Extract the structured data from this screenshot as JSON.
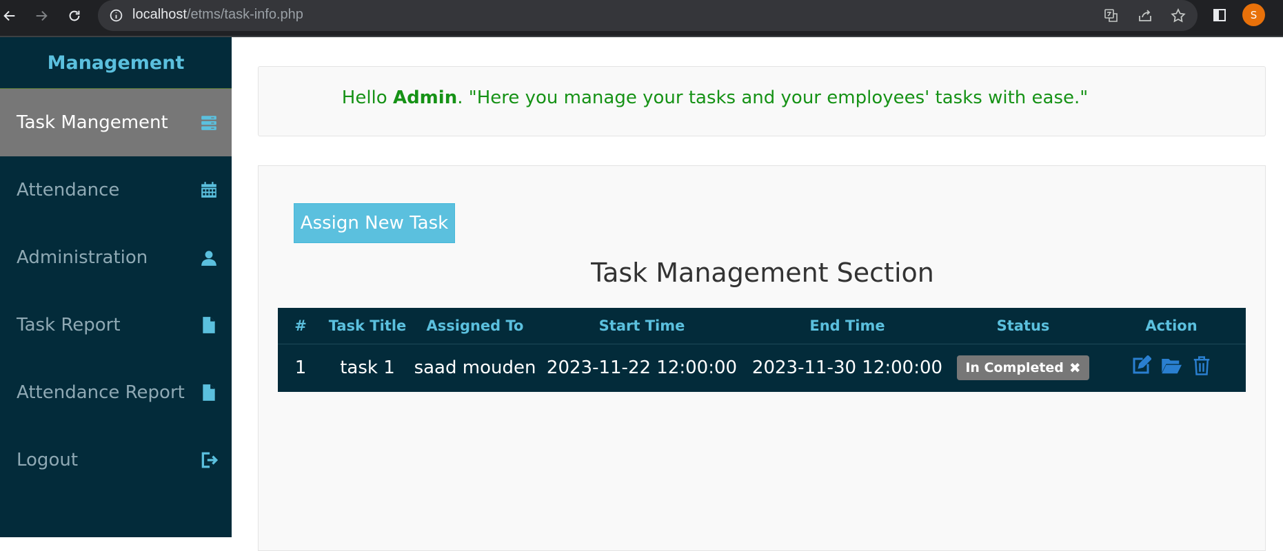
{
  "browser": {
    "url_host": "localhost",
    "url_path": "/etms/task-info.php",
    "profile_initial": "S"
  },
  "sidebar": {
    "title": "Management",
    "items": [
      {
        "label": "Task Mangement",
        "icon": "server-icon",
        "active": true
      },
      {
        "label": "Attendance",
        "icon": "calendar-icon",
        "active": false
      },
      {
        "label": "Administration",
        "icon": "user-icon",
        "active": false
      },
      {
        "label": "Task Report",
        "icon": "file-icon",
        "active": false
      },
      {
        "label": "Attendance Report",
        "icon": "file-icon",
        "active": false
      },
      {
        "label": "Logout",
        "icon": "logout-icon",
        "active": false
      }
    ]
  },
  "welcome": {
    "hello": "Hello",
    "user": "Admin",
    "message": ". \"Here you manage your tasks and your employees' tasks with ease.\""
  },
  "main": {
    "assign_button": "Assign New Task",
    "section_title": "Task Management Section",
    "table": {
      "headers": [
        "#",
        "Task Title",
        "Assigned To",
        "Start Time",
        "End Time",
        "Status",
        "Action"
      ],
      "rows": [
        {
          "num": "1",
          "title": "task 1",
          "assigned_to": "saad mouden",
          "start": "2023-11-22 12:00:00",
          "end": "2023-11-30 12:00:00",
          "status": "In Completed",
          "status_icon": "✖"
        }
      ]
    }
  },
  "colors": {
    "sidebar_bg": "#032b3a",
    "accent": "#5bc0de",
    "active_item": "#777777",
    "welcome_text": "#169216",
    "action_icons": "#2a7fd0"
  }
}
